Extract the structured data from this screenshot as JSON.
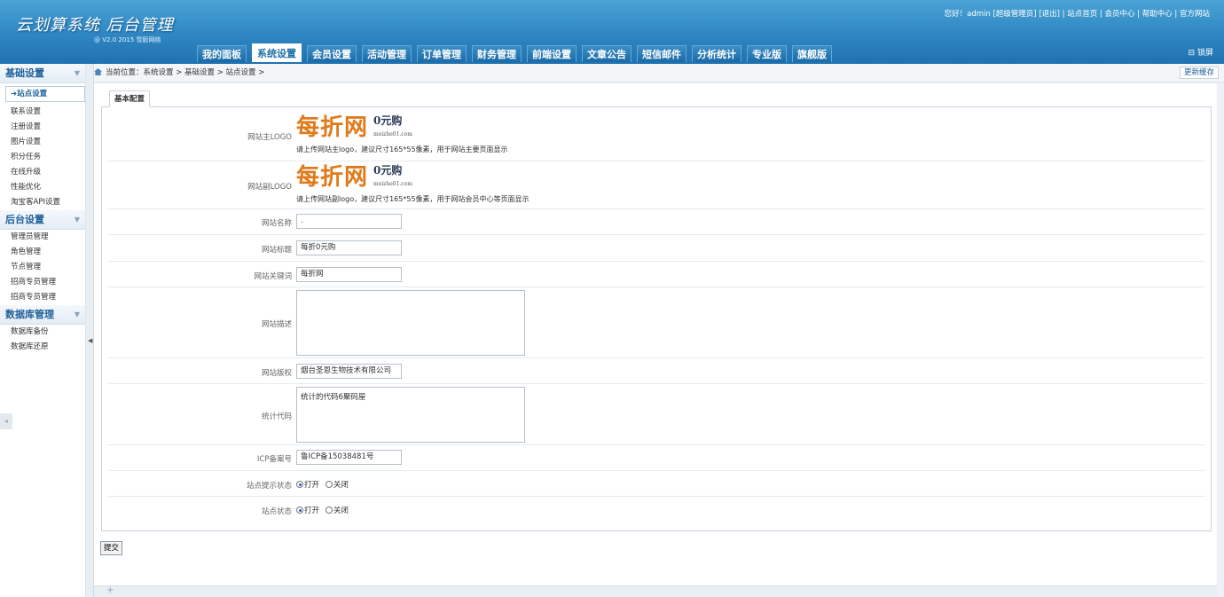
{
  "header": {
    "title": "云划算系统 后台管理",
    "subtitle": "@ V2.0 2015 雪毅网络",
    "top_links": "您好！admin [超级管理员] [退出] | 站点首页 | 会员中心 | 帮助中心 | 官方网站",
    "lock_label": "锁屏",
    "nav": [
      {
        "label": "我的面板"
      },
      {
        "label": "系统设置",
        "active": true
      },
      {
        "label": "会员设置"
      },
      {
        "label": "活动管理"
      },
      {
        "label": "订单管理"
      },
      {
        "label": "财务管理"
      },
      {
        "label": "前端设置"
      },
      {
        "label": "文章公告"
      },
      {
        "label": "短信邮件"
      },
      {
        "label": "分析统计"
      },
      {
        "label": "专业版"
      },
      {
        "label": "旗舰版"
      }
    ]
  },
  "sidebar": {
    "groups": [
      {
        "title": "基础设置",
        "items": [
          "站点设置",
          "联系设置",
          "注册设置",
          "图片设置",
          "积分任务",
          "在线升级",
          "性能优化",
          "淘宝客API设置"
        ]
      },
      {
        "title": "后台设置",
        "items": [
          "管理员管理",
          "角色管理",
          "节点管理",
          "招商专员管理",
          "招商专员管理"
        ]
      },
      {
        "title": "数据库管理",
        "items": [
          "数据库备份",
          "数据库还原"
        ]
      }
    ],
    "active_item": "➜站点设置"
  },
  "breadcrumb": "当前位置：系统设置 > 基础设置 > 站点设置 >",
  "refresh_label": "更新缓存",
  "panel_tab": "基本配置",
  "form": {
    "main_logo": {
      "label": "网站主LOGO",
      "logo_text": "每折网",
      "logo_price": "0元购",
      "logo_domain": "meizhe01.com",
      "hint": "请上传网站主logo，建议尺寸165*55像素，用于网站主要页面显示"
    },
    "sub_logo": {
      "label": "网站副LOGO",
      "logo_text": "每折网",
      "logo_price": "0元购",
      "logo_domain": "meizhe01.com",
      "hint": "请上传网站副logo，建议尺寸165*55像素，用于网站会员中心等页面显示"
    },
    "site_name": {
      "label": "网站名称",
      "value": "."
    },
    "site_title": {
      "label": "网站标题",
      "value": "每折0元购"
    },
    "site_keywords": {
      "label": "网站关键词",
      "value": "每折网"
    },
    "site_desc": {
      "label": "网站描述",
      "value": ""
    },
    "copyright": {
      "label": "网站版权",
      "value": "烟台圣恩生物技术有限公司"
    },
    "stat_code": {
      "label": "统计代码",
      "value": "统计的代码6聚码屋"
    },
    "icp": {
      "label": "ICP备案号",
      "value": "鲁ICP备15038481号"
    },
    "site_notice_status": {
      "label": "站点提示状态",
      "on": "打开",
      "off": "关闭",
      "selected": "打开"
    },
    "site_status": {
      "label": "站点状态",
      "on": "打开",
      "off": "关闭",
      "selected": "打开"
    }
  },
  "submit_label": "提交",
  "footer_plus": "+"
}
